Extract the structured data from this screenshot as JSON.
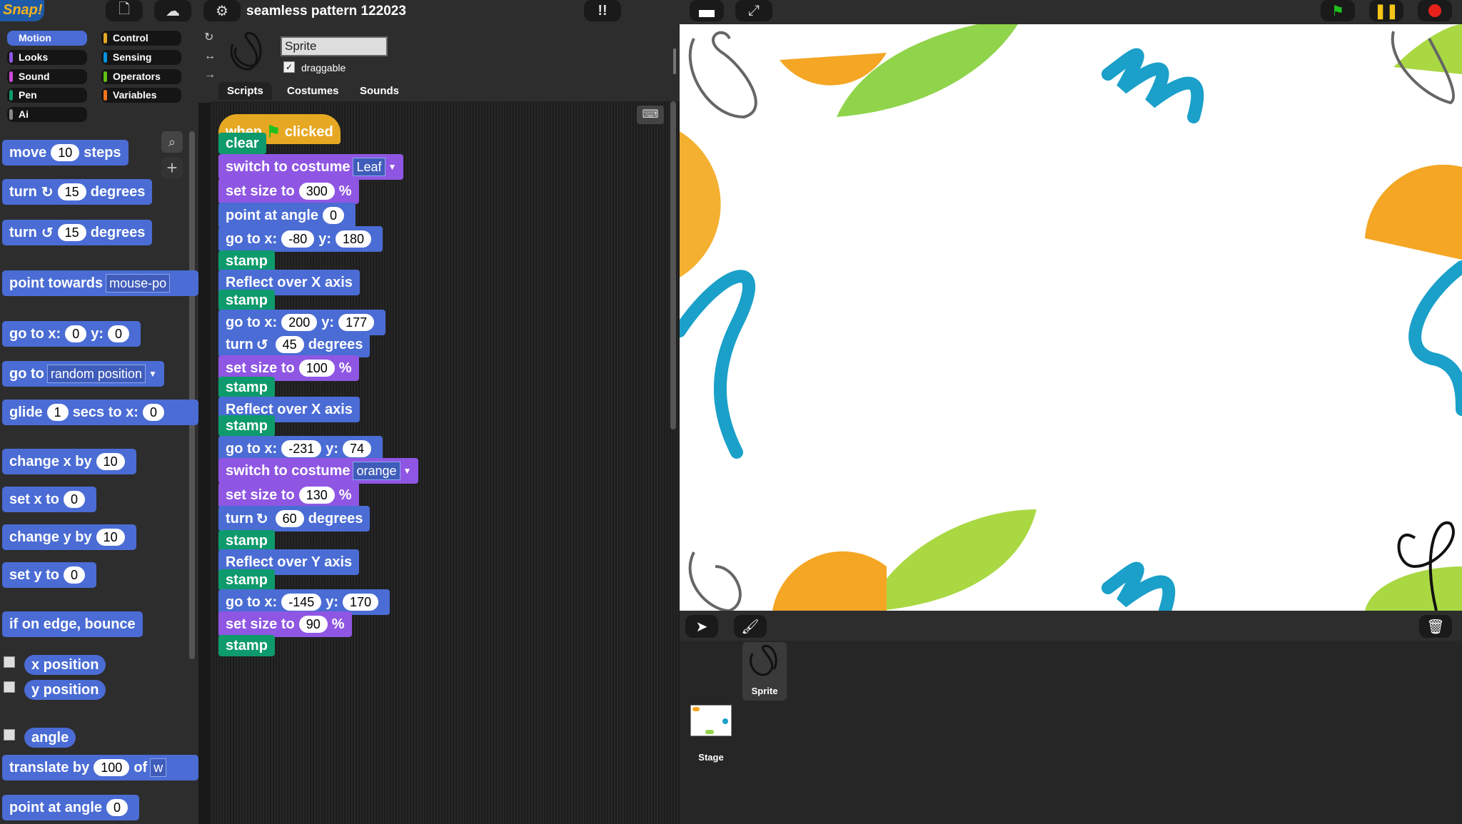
{
  "app": {
    "logo_text": "Snap!",
    "project_title": "seamless pattern 122023"
  },
  "categories": [
    {
      "label": "Motion",
      "color": "#4a6cd4",
      "selected": true
    },
    {
      "label": "Looks",
      "color": "#8f56e3"
    },
    {
      "label": "Sound",
      "color": "#cf4ad9"
    },
    {
      "label": "Pen",
      "color": "#0e9a6c"
    },
    {
      "label": "Ai",
      "color": "#888888"
    },
    {
      "label": "Control",
      "color": "#e6a822"
    },
    {
      "label": "Sensing",
      "color": "#0494dc"
    },
    {
      "label": "Operators",
      "color": "#62c213"
    },
    {
      "label": "Variables",
      "color": "#f3761d"
    }
  ],
  "palette": {
    "move": {
      "a": "move",
      "v": "10",
      "b": "steps"
    },
    "turn_cw": {
      "a": "turn",
      "icon": "↻",
      "v": "15",
      "b": "degrees"
    },
    "turn_ccw": {
      "a": "turn",
      "icon": "↺",
      "v": "15",
      "b": "degrees"
    },
    "point_towards": {
      "a": "point towards",
      "v": "mouse-po"
    },
    "go_to_xy": {
      "a": "go to x:",
      "x": "0",
      "b": "y:",
      "y": "0"
    },
    "go_to": {
      "a": "go to",
      "v": "random position"
    },
    "glide": {
      "a": "glide",
      "v": "1",
      "b": "secs to x:",
      "c": "0"
    },
    "change_x": {
      "a": "change x by",
      "v": "10"
    },
    "set_x": {
      "a": "set x to",
      "v": "0"
    },
    "change_y": {
      "a": "change y by",
      "v": "10"
    },
    "set_y": {
      "a": "set y to",
      "v": "0"
    },
    "bounce": "if on edge, bounce",
    "x_position": "x position",
    "y_position": "y position",
    "angle": "angle",
    "translate": {
      "a": "translate by",
      "v": "100",
      "b": "of",
      "c": "w"
    },
    "point_at_angle": {
      "a": "point at angle",
      "v": "0"
    }
  },
  "sprite": {
    "name": "Sprite",
    "draggable_label": "draggable",
    "draggable": "✓"
  },
  "tabs": [
    "Scripts",
    "Costumes",
    "Sounds"
  ],
  "script": {
    "hat": {
      "a": "when",
      "b": "clicked"
    },
    "blocks": [
      {
        "kind": "pen",
        "text": "clear"
      },
      {
        "kind": "loo",
        "text": "switch to costume",
        "drop": "Leaf"
      },
      {
        "kind": "loo",
        "text": "set size to",
        "v": "300",
        "suffix": "%"
      },
      {
        "kind": "mot",
        "text": "point at angle",
        "v": "0"
      },
      {
        "kind": "mot",
        "text": "go to x:",
        "x": "-80",
        "y": "180"
      },
      {
        "kind": "pen",
        "text": "stamp"
      },
      {
        "kind": "mot",
        "text": "Reflect over X axis"
      },
      {
        "kind": "pen",
        "text": "stamp"
      },
      {
        "kind": "mot",
        "text": "go to x:",
        "x": "200",
        "y": "177"
      },
      {
        "kind": "mot",
        "text": "turn",
        "icon": "↺",
        "v": "45",
        "suffix": "degrees"
      },
      {
        "kind": "loo",
        "text": "set size to",
        "v": "100",
        "suffix": "%"
      },
      {
        "kind": "pen",
        "text": "stamp"
      },
      {
        "kind": "mot",
        "text": "Reflect over X axis"
      },
      {
        "kind": "pen",
        "text": "stamp"
      },
      {
        "kind": "mot",
        "text": "go to x:",
        "x": "-231",
        "y": "74"
      },
      {
        "kind": "loo",
        "text": "switch to costume",
        "drop": "orange"
      },
      {
        "kind": "loo",
        "text": "set size to",
        "v": "130",
        "suffix": "%"
      },
      {
        "kind": "mot",
        "text": "turn",
        "icon": "↻",
        "v": "60",
        "suffix": "degrees"
      },
      {
        "kind": "pen",
        "text": "stamp"
      },
      {
        "kind": "mot",
        "text": "Reflect over Y axis"
      },
      {
        "kind": "pen",
        "text": "stamp"
      },
      {
        "kind": "mot",
        "text": "go to x:",
        "x": "-145",
        "y": "170"
      },
      {
        "kind": "loo",
        "text": "set size to",
        "v": "90",
        "suffix": "%"
      },
      {
        "kind": "pen",
        "text": "stamp"
      }
    ]
  },
  "corral": {
    "sprite_label": "Sprite",
    "stage_label": "Stage"
  },
  "colors": {
    "motion": "#4a6cd4",
    "looks": "#8f56e3",
    "pen": "#0e9a6c",
    "control": "#e6a822"
  }
}
